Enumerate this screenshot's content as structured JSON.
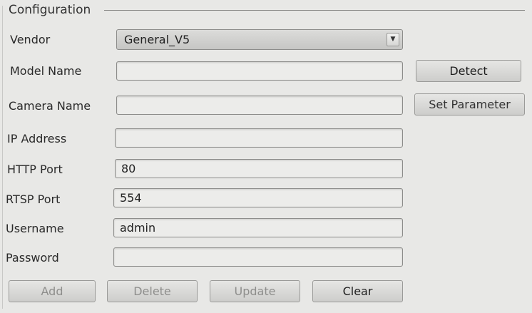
{
  "group": {
    "title": "Configuration"
  },
  "vendor": {
    "label": "Vendor",
    "value": "General_V5"
  },
  "model_name": {
    "label": "Model Name",
    "value": ""
  },
  "camera_name": {
    "label": "Camera Name",
    "value": ""
  },
  "ip_address": {
    "label": "IP Address",
    "value": ""
  },
  "http_port": {
    "label": "HTTP Port",
    "value": "80"
  },
  "rtsp_port": {
    "label": "RTSP Port",
    "value": "554"
  },
  "username": {
    "label": "Username",
    "value": "admin"
  },
  "password": {
    "label": "Password",
    "value": ""
  },
  "buttons": {
    "detect": "Detect",
    "set_parameter": "Set Parameter",
    "add": "Add",
    "delete": "Delete",
    "update": "Update",
    "clear": "Clear"
  },
  "icons": {
    "dropdown": "chevron-down-icon"
  }
}
